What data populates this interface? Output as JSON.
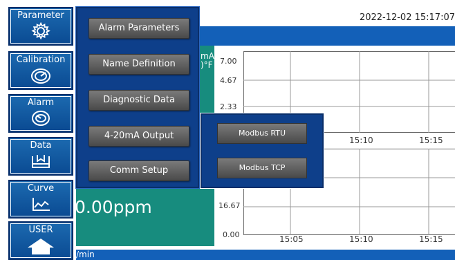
{
  "header": {
    "datetime": "2022-12-02 15:17:07"
  },
  "nav": {
    "parameter": "Parameter",
    "calibration": "Calibration",
    "alarm": "Alarm",
    "data": "Data",
    "curve": "Curve",
    "user": "USER"
  },
  "menu": {
    "items": [
      "Alarm Parameters",
      "Name Definition",
      "Diagnostic Data",
      "4-20mA Output",
      "Comm Setup"
    ]
  },
  "submenu": {
    "items": [
      "Modbus RTU",
      "Modbus TCP"
    ]
  },
  "reading": {
    "unit_text_line1": "mA",
    "unit_text_line2": ")°F",
    "value": "0.00ppm",
    "footer_partial": "/min"
  },
  "chart_top": {
    "y_ticks": [
      "7.00",
      "4.67",
      "2.33"
    ],
    "x_ticks": [
      "15:10",
      "15:15"
    ]
  },
  "chart_bottom": {
    "y_ticks": [
      "16.67",
      "0.00"
    ],
    "x_ticks": [
      "15:05",
      "15:10",
      "15:15"
    ]
  },
  "colors": {
    "nav_blue": "#0a4a92",
    "menu_blue": "#0e3f8a",
    "teal": "#178c7e",
    "button_grey": "#5a5a5a"
  }
}
